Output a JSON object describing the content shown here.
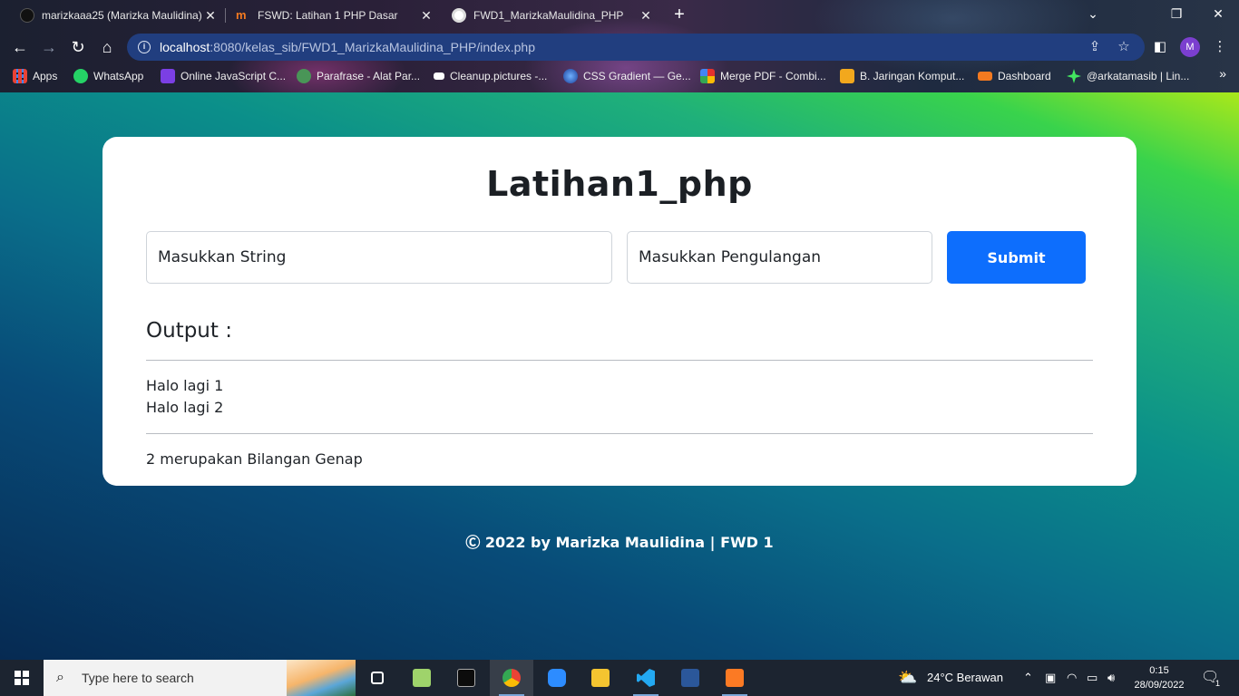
{
  "browser": {
    "tabs": [
      {
        "label": "marizkaaa25 (Marizka Maulidina)",
        "icon": "github-icon"
      },
      {
        "label": "FSWD: Latihan 1 PHP Dasar",
        "icon": "dicoding-icon"
      },
      {
        "label": "FWD1_MarizkaMaulidina_PHP",
        "icon": "globe-icon"
      }
    ],
    "url_host": "localhost",
    "url_path": ":8080/kelas_sib/FWD1_MarizkaMaulidina_PHP/index.php",
    "profile_initial": "M",
    "bookmarks": [
      {
        "label": "Apps",
        "icon": "apps-grid-icon",
        "color": "#e94235"
      },
      {
        "label": "WhatsApp",
        "icon": "whatsapp-icon",
        "color": "#25d366"
      },
      {
        "label": "Online JavaScript C...",
        "icon": "js-compiler-icon",
        "color": "#7b3fe4"
      },
      {
        "label": "Parafrase - Alat Par...",
        "icon": "quillbot-icon",
        "color": "#499557"
      },
      {
        "label": "Cleanup.pictures -...",
        "icon": "cleanup-icon",
        "color": "#ffffff"
      },
      {
        "label": "CSS Gradient — Ge...",
        "icon": "css-gradient-icon",
        "color": "#2d6fe0"
      },
      {
        "label": "Merge PDF - Combi...",
        "icon": "merge-pdf-icon",
        "color": "#e5322d"
      },
      {
        "label": "B. Jaringan Komput...",
        "icon": "123doc-icon",
        "color": "#f2a81d"
      },
      {
        "label": "Dashboard",
        "icon": "dicoding-icon",
        "color": "#f47a20"
      },
      {
        "label": "@arkatamasib | Lin...",
        "icon": "linktree-icon",
        "color": "#43e660"
      }
    ]
  },
  "page": {
    "title": "Latihan1_php",
    "string_placeholder": "Masukkan String",
    "repeat_placeholder": "Masukkan Pengulangan",
    "submit_label": "Submit",
    "output_heading": "Output :",
    "output_lines": [
      "Halo lagi 1",
      "Halo lagi 2"
    ],
    "result_text": "2 merupakan Bilangan Genap",
    "footer": "Ⓒ  2022 by Marizka Maulidina | FWD 1"
  },
  "taskbar": {
    "search_placeholder": "Type here to search",
    "weather": "24°C  Berawan",
    "time": "0:15",
    "date": "28/09/2022",
    "notification_count": "1"
  },
  "colors": {
    "primary_button": "#0d6efd",
    "omnibox": "#213e7f"
  }
}
